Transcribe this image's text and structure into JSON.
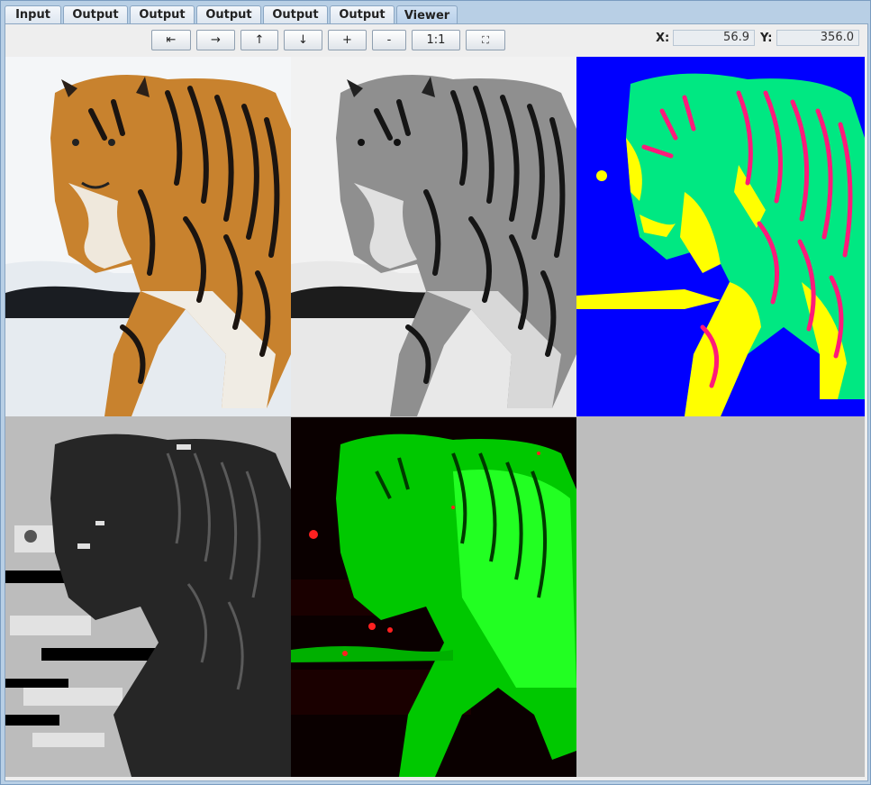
{
  "tabs": [
    {
      "label": "Input",
      "active": false
    },
    {
      "label": "Output",
      "active": false
    },
    {
      "label": "Output",
      "active": false
    },
    {
      "label": "Output",
      "active": false
    },
    {
      "label": "Output",
      "active": false
    },
    {
      "label": "Output",
      "active": false
    },
    {
      "label": "Viewer",
      "active": true
    }
  ],
  "toolbar": {
    "left_label": "⇤",
    "right_label": "→",
    "up_label": "↑",
    "down_label": "↓",
    "zoom_in_label": "+",
    "zoom_out_label": "-",
    "actual_size_label": "1:1",
    "fit_label": "⛶"
  },
  "coords": {
    "x_label": "X:",
    "x_value": "56.9",
    "y_label": "Y:",
    "y_value": "356.0"
  },
  "colors": {
    "segment_background": "#0000ff",
    "segment_class_1": "#00e882",
    "segment_class_2": "#ff1a7a",
    "segment_class_3": "#ffff00",
    "flow_green": "#00ff00",
    "flow_red": "#ff2020"
  },
  "images": [
    {
      "name": "original-color",
      "icon": "tiger-photo"
    },
    {
      "name": "grayscale",
      "icon": "tiger-gray"
    },
    {
      "name": "segmentation",
      "icon": "tiger-segmentation"
    },
    {
      "name": "gradient-direction",
      "icon": "tiger-gradient"
    },
    {
      "name": "color-flow",
      "icon": "tiger-flow"
    }
  ]
}
